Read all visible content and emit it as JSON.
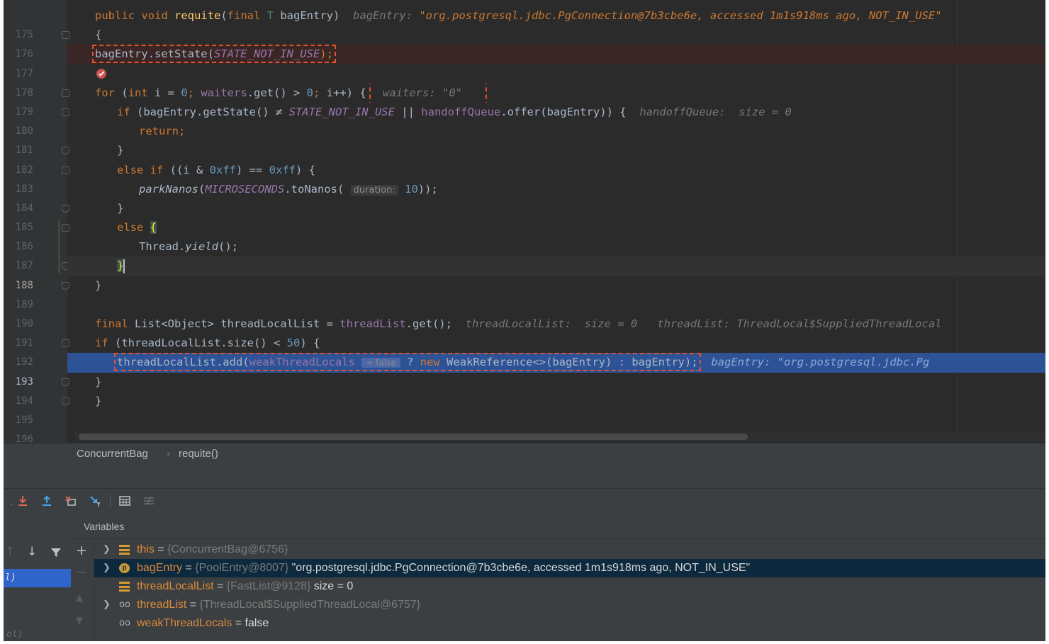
{
  "editor": {
    "lines": [
      {
        "n": "175"
      },
      {
        "n": "176"
      },
      {
        "n": "177"
      },
      {
        "n": "178"
      },
      {
        "n": "179"
      },
      {
        "n": "180"
      },
      {
        "n": "181"
      },
      {
        "n": "182"
      },
      {
        "n": "183"
      },
      {
        "n": "184"
      },
      {
        "n": "185"
      },
      {
        "n": "186"
      },
      {
        "n": "187"
      },
      {
        "n": "188"
      },
      {
        "n": "189"
      },
      {
        "n": "190"
      },
      {
        "n": "191"
      },
      {
        "n": "192"
      },
      {
        "n": "193"
      },
      {
        "n": "194"
      },
      {
        "n": "195"
      },
      {
        "n": "196"
      }
    ],
    "code": {
      "l175_kw": "public void ",
      "l175_fn": "requite",
      "l175_p1": "(",
      "l175_kw2": "final ",
      "l175_tp": "T ",
      "l175_p2": "bagEntry)",
      "l175_hint_label": "bagEntry: ",
      "l175_hint_value": "\"org.postgresql.jdbc.PgConnection@7b3cbe6e, accessed 1m1s918ms ago, NOT_IN_USE\"",
      "l176": "{",
      "l177_a": "bagEntry.setState(",
      "l177_const": "STATE_NOT_IN_USE",
      "l177_b": ");",
      "l179_kw": "for ",
      "l179_a": "(",
      "l179_kw2": "int ",
      "l179_b": "i = ",
      "l179_n1": "0",
      "l179_semi1": "; ",
      "l179_fld": "waiters",
      "l179_c": ".get() > ",
      "l179_n2": "0",
      "l179_semi2": "; ",
      "l179_d": "i++) {",
      "l179_hint": "waiters: \"0\"",
      "l180_kw": "if ",
      "l180_a": "(bagEntry.getState() ≠ ",
      "l180_const": "STATE_NOT_IN_USE",
      "l180_b": " || ",
      "l180_fld": "handoffQueue",
      "l180_c": ".offer(bagEntry)) {",
      "l180_hint": "handoffQueue:  size = 0",
      "l181_kw": "return",
      "l181_semi": ";",
      "l182": "}",
      "l183_kw": "else if ",
      "l183_a": "((i & ",
      "l183_n1": "0xff",
      "l183_b": ") == ",
      "l183_n2": "0xff",
      "l183_c": ") {",
      "l184_fn": "parkNanos",
      "l184_a": "(",
      "l184_const": "MICROSECONDS",
      "l184_b": ".toNanos(",
      "l184_hint": "duration:",
      "l184_n": "10",
      "l184_c": "));",
      "l185": "}",
      "l186_kw": "else ",
      "l186_brace": "{",
      "l187_a": "Thread.",
      "l187_st": "yield",
      "l187_b": "();",
      "l188_brace": "}",
      "l189": "}",
      "l191_kw": "final ",
      "l191_a": "List<Object> threadLocalList = ",
      "l191_fld": "threadList",
      "l191_b": ".get();",
      "l191_hint1": "threadLocalList:  size = 0",
      "l191_hint2": "threadList: ThreadLocal$SuppliedThreadLocal",
      "l192_kw": "if ",
      "l192_a": "(threadLocalList.size() < ",
      "l192_n": "50",
      "l192_b": ") {",
      "l193_a": "threadLocalList.add(",
      "l193_fld": "weakThreadLocals",
      "l193_val": "= false",
      "l193_b": " ? ",
      "l193_kw": "new ",
      "l193_c": "WeakReference<>(bagEntry) : bagEntry);",
      "l193_hint": "bagEntry: \"org.postgresql.jdbc.Pg",
      "l194": "}",
      "l195": "}"
    }
  },
  "breadcrumb": {
    "class_name": "ConcurrentBag",
    "separator": "›",
    "method_name": "requite()"
  },
  "debugger": {
    "variables_title": "Variables",
    "frame_label": "l)",
    "frame_dim": "ol)",
    "variables": [
      {
        "name": "this",
        "eq": " = ",
        "type": "{ConcurrentBag@6756}",
        "value": ""
      },
      {
        "name": "bagEntry",
        "eq": " = ",
        "type": "{PoolEntry@8007}",
        "value": " \"org.postgresql.jdbc.PgConnection@7b3cbe6e, accessed 1m1s918ms ago, NOT_IN_USE\""
      },
      {
        "name": "threadLocalList",
        "eq": " = ",
        "type": "{FastList@9128}",
        "value": "  size = 0"
      },
      {
        "name": "threadList",
        "eq": " = ",
        "type": "{ThreadLocal$SuppliedThreadLocal@6757}",
        "value": ""
      },
      {
        "name": "weakThreadLocals",
        "eq": " = ",
        "type": "",
        "value": "false"
      }
    ],
    "param_badge": "p"
  },
  "icons": {
    "breakpoint": "breakpoint-check-icon",
    "toolbar": [
      "step-into-icon",
      "step-out-icon",
      "drop-frame-icon",
      "run-to-cursor-icon",
      "evaluate-icon",
      "trace-icon"
    ]
  },
  "colors": {
    "editor_bg": "#2b2b2b",
    "keyword": "#cc7832",
    "method": "#ffc66d",
    "number": "#6897bb",
    "field": "#9876aa",
    "exec_line": "#2d5296",
    "breakpoint_line": "#3b2626",
    "annotation_box": "#e0532f"
  }
}
